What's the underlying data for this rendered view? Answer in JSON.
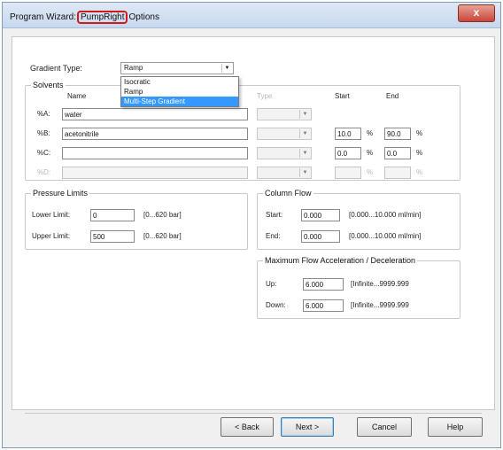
{
  "window": {
    "title_prefix": "Program Wizard: ",
    "title_highlight": "PumpRight",
    "title_suffix": " Options",
    "close_glyph": "x"
  },
  "gradient": {
    "label": "Gradient Type:",
    "value": "Ramp",
    "options": [
      "Isocratic",
      "Ramp",
      "Multi-Step Gradient"
    ],
    "highlighted_option": "Multi-Step Gradient"
  },
  "solvents": {
    "group_label": "Solvents",
    "col_name": "Name",
    "col_type": "Type",
    "col_start": "Start",
    "col_end": "End",
    "rows": [
      {
        "label": "%A:",
        "name": "water",
        "start": "",
        "end": "",
        "unit_start": "",
        "unit_end": ""
      },
      {
        "label": "%B:",
        "name": "acetonitrile",
        "start": "10.0",
        "end": "90.0",
        "unit_start": "%",
        "unit_end": "%"
      },
      {
        "label": "%C:",
        "name": "",
        "start": "0.0",
        "end": "0.0",
        "unit_start": "%",
        "unit_end": "%"
      },
      {
        "label": "%D:",
        "name": "",
        "start": "",
        "end": "",
        "unit_start": "%",
        "unit_end": "%"
      }
    ]
  },
  "pressure": {
    "group_label": "Pressure Limits",
    "lower_label": "Lower Limit:",
    "lower_value": "0",
    "lower_range": "[0...620 bar]",
    "upper_label": "Upper Limit:",
    "upper_value": "500",
    "upper_range": "[0...620 bar]"
  },
  "column_flow": {
    "group_label": "Column Flow",
    "start_label": "Start:",
    "start_value": "0.000",
    "start_range": "[0.000...10.000 ml/min]",
    "end_label": "End:",
    "end_value": "0.000",
    "end_range": "[0.000...10.000 ml/min]"
  },
  "max_flow": {
    "group_label": "Maximum Flow Acceleration / Deceleration",
    "up_label": "Up:",
    "up_value": "6.000",
    "up_range": "[Infinite...9999.999",
    "down_label": "Down:",
    "down_value": "6.000",
    "down_range": "[Infinite...9999.999"
  },
  "buttons": {
    "back": "< Back",
    "next": "Next >",
    "cancel": "Cancel",
    "help": "Help"
  }
}
